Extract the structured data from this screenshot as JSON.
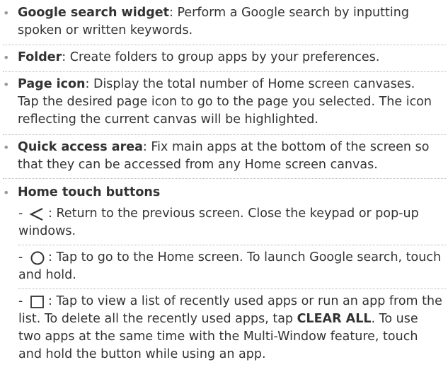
{
  "items": [
    {
      "term": "Google search widget",
      "text": ": Perform a Google search by inputting spoken or written keywords."
    },
    {
      "term": "Folder",
      "text": ": Create folders to group apps by your preferences."
    },
    {
      "term": "Page icon",
      "text": ": Display the total number of Home screen canvases. Tap the desired page icon to go to the page you selected. The icon reflecting the current canvas will be highlighted."
    },
    {
      "term": "Quick access area",
      "text": ": Fix main apps at the bottom of the screen so that they can be accessed from any Home screen canvas."
    },
    {
      "term": "Home touch buttons"
    }
  ],
  "home_buttons": [
    {
      "icon": "back-triangle-icon",
      "text": ": Return to the previous screen. Close the keypad or pop-up windows."
    },
    {
      "icon": "home-circle-icon",
      "text": ": Tap to go to the Home screen. To launch Google search, touch and hold."
    },
    {
      "icon": "recents-square-icon",
      "text_before": ": Tap to view a list of recently used apps or run an app from the list. To delete all the recently used apps, tap ",
      "bold": "CLEAR ALL",
      "text_after": ". To use two apps at the same time with the Multi-Window feature, touch and hold the button while using an app."
    }
  ],
  "colors": {
    "text": "#333333",
    "bullet": "#9a9a9a",
    "separator": "#b9b9b9"
  }
}
